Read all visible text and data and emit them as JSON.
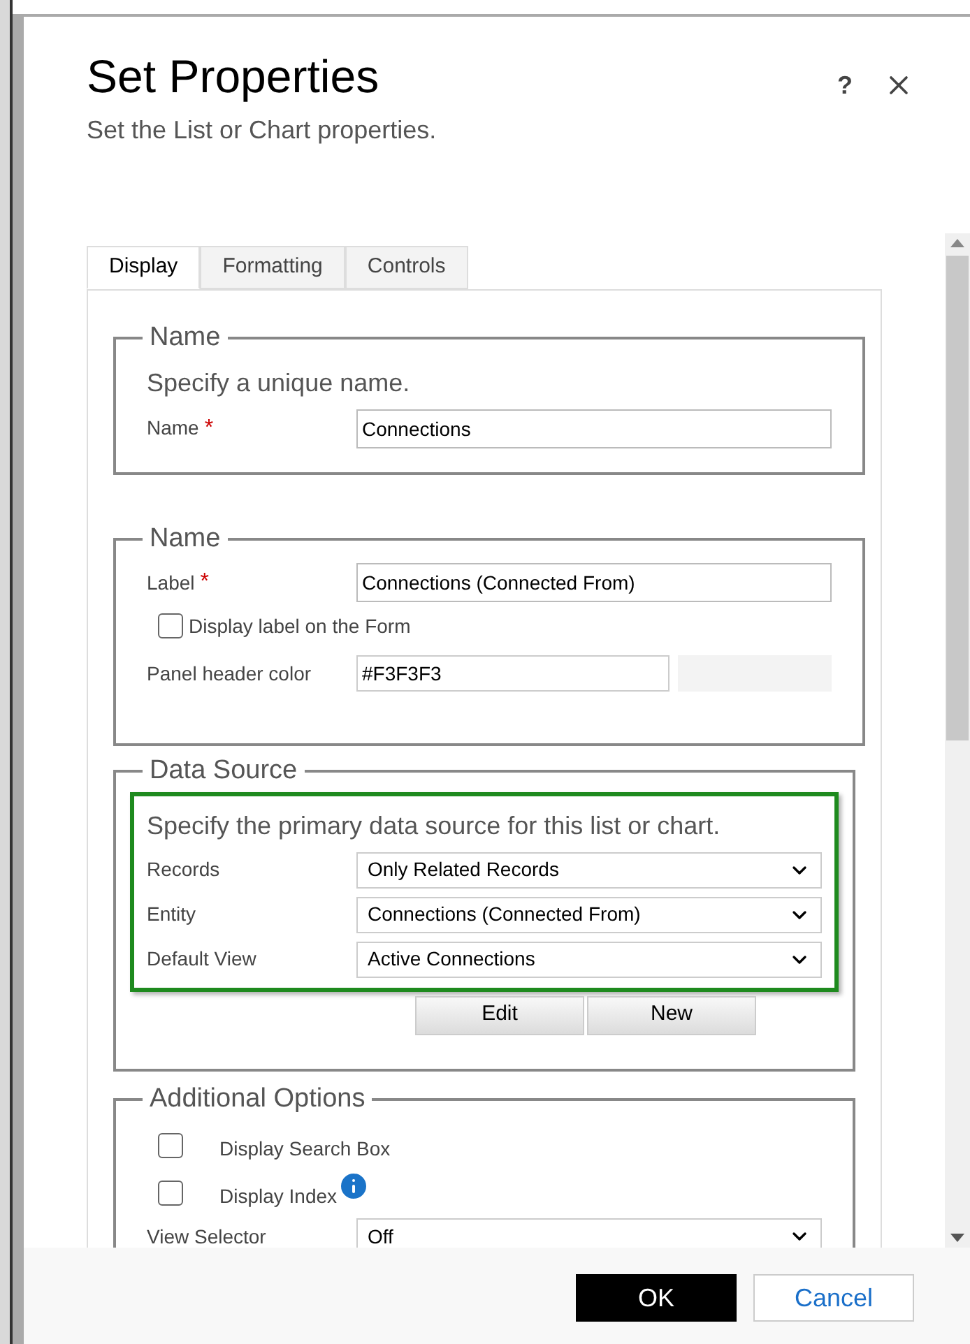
{
  "dialog": {
    "title": "Set Properties",
    "subtitle": "Set the List or Chart properties.",
    "help_glyph": "?"
  },
  "tabs": [
    {
      "label": "Display",
      "selected": true
    },
    {
      "label": "Formatting",
      "selected": false
    },
    {
      "label": "Controls",
      "selected": false
    }
  ],
  "sections": [
    {
      "legend": "Name",
      "hint": "Specify a unique name.",
      "highlighted": false,
      "rows": [
        {
          "kind": "text",
          "label": "Name",
          "required_mark": "*",
          "value": "Connections"
        }
      ]
    },
    {
      "legend": "Name",
      "highlighted": false,
      "rows": [
        {
          "kind": "text",
          "label": "Label",
          "required_mark": "*",
          "value": "Connections (Connected From)"
        },
        {
          "kind": "checkbox",
          "label": "Display label on the Form",
          "checked": false
        },
        {
          "kind": "color",
          "label": "Panel header color",
          "value": "#F3F3F3"
        }
      ]
    },
    {
      "legend": "Data Source",
      "hint": "Specify the primary data source for this list or chart.",
      "highlighted": true,
      "rows": [
        {
          "kind": "select",
          "label": "Records",
          "value": "Only Related Records"
        },
        {
          "kind": "select",
          "label": "Entity",
          "value": "Connections (Connected From)"
        },
        {
          "kind": "select",
          "label": "Default View",
          "value": "Active Connections"
        }
      ],
      "buttons": [
        "Edit",
        "New"
      ]
    },
    {
      "legend": "Additional Options",
      "highlighted": false,
      "rows": [
        {
          "kind": "option",
          "label": "Display Search Box",
          "checked": false,
          "info": false
        },
        {
          "kind": "option",
          "label": "Display Index",
          "checked": false,
          "info": true
        },
        {
          "kind": "select",
          "label": "View Selector",
          "value": "Off"
        }
      ]
    }
  ],
  "footer": [
    {
      "label": "OK",
      "kind": "primary"
    },
    {
      "label": "Cancel",
      "kind": "secondary"
    }
  ]
}
